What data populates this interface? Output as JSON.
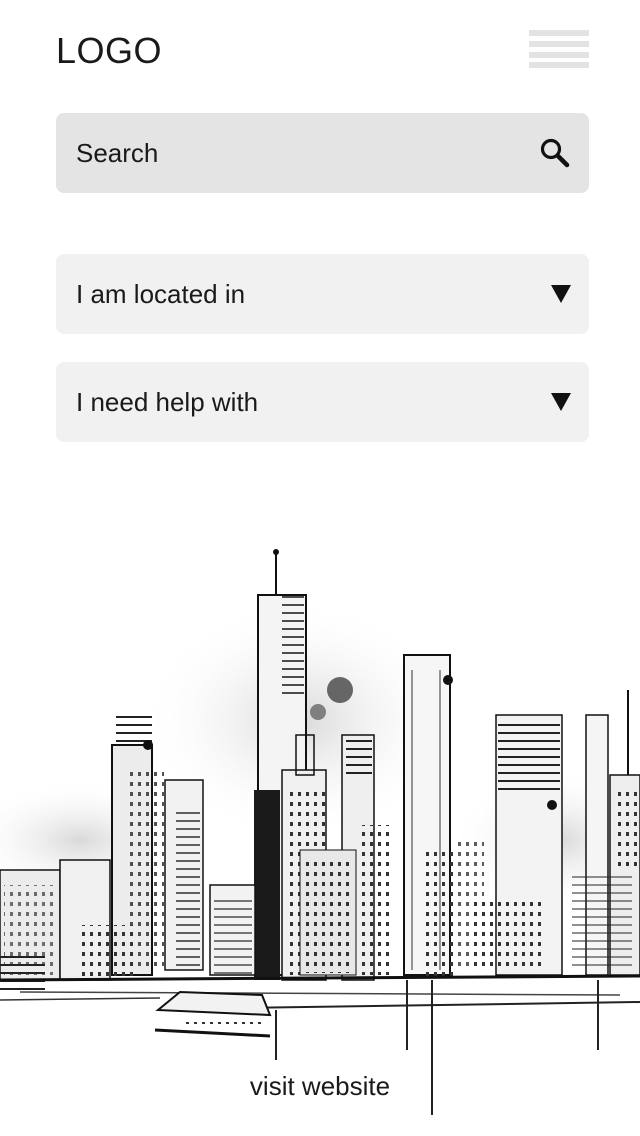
{
  "header": {
    "logo_text": "LOGO",
    "menu_icon": "hamburger-menu-icon"
  },
  "search": {
    "placeholder": "Search",
    "icon": "search-icon"
  },
  "filters": {
    "location_label": "I am located in",
    "help_label": "I need help with",
    "dropdown_icon": "triangle-down-icon"
  },
  "illustration": {
    "subject": "city-skyline-sketch"
  },
  "footer": {
    "link_label": "visit website"
  }
}
